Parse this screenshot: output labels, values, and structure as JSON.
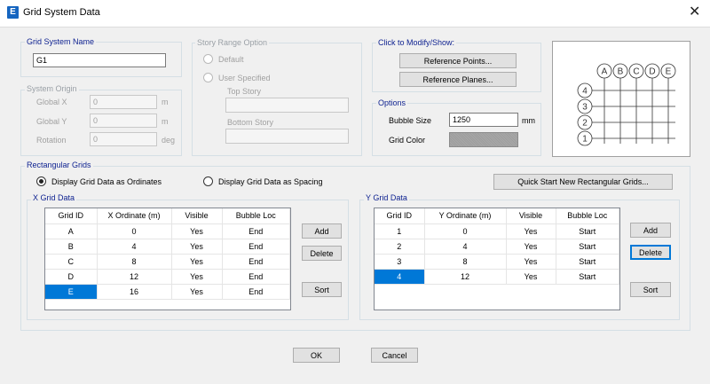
{
  "window": {
    "title": "Grid System Data",
    "app_icon": "E",
    "close_glyph": "✕"
  },
  "grid_system_name": {
    "legend": "Grid System Name",
    "value": "G1"
  },
  "story_range": {
    "legend": "Story Range Option",
    "default_label": "Default",
    "user_specified_label": "User Specified",
    "top_story_label": "Top Story",
    "bottom_story_label": "Bottom Story"
  },
  "system_origin": {
    "legend": "System Origin",
    "global_x": {
      "label": "Global  X",
      "value": "0",
      "unit": "m"
    },
    "global_y": {
      "label": "Global  Y",
      "value": "0",
      "unit": "m"
    },
    "rotation": {
      "label": "Rotation",
      "value": "0",
      "unit": "deg"
    }
  },
  "click_to_modify": {
    "legend": "Click to Modify/Show:",
    "reference_points": "Reference Points...",
    "reference_planes": "Reference Planes..."
  },
  "options": {
    "legend": "Options",
    "bubble_size_label": "Bubble Size",
    "bubble_size_value": "1250",
    "bubble_size_unit": "mm",
    "grid_color_label": "Grid Color",
    "grid_color": "#a4a4a4"
  },
  "preview": {
    "x_bubbles": [
      "A",
      "B",
      "C",
      "D",
      "E"
    ],
    "y_bubbles": [
      "4",
      "3",
      "2",
      "1"
    ]
  },
  "rectangular_grids": {
    "legend": "Rectangular Grids",
    "ordinates_label": "Display Grid Data as Ordinates",
    "spacing_label": "Display Grid Data as Spacing",
    "selected": "ordinates",
    "quick_start": "Quick Start New Rectangular Grids..."
  },
  "x_grid": {
    "legend": "X Grid Data",
    "columns": [
      "Grid ID",
      "X Ordinate (m)",
      "Visible",
      "Bubble Loc"
    ],
    "rows": [
      [
        "A",
        "0",
        "Yes",
        "End"
      ],
      [
        "B",
        "4",
        "Yes",
        "End"
      ],
      [
        "C",
        "8",
        "Yes",
        "End"
      ],
      [
        "D",
        "12",
        "Yes",
        "End"
      ],
      [
        "E",
        "16",
        "Yes",
        "End"
      ]
    ],
    "selected_row": 4,
    "add": "Add",
    "delete": "Delete",
    "sort": "Sort"
  },
  "y_grid": {
    "legend": "Y Grid Data",
    "columns": [
      "Grid ID",
      "Y Ordinate (m)",
      "Visible",
      "Bubble Loc"
    ],
    "rows": [
      [
        "1",
        "0",
        "Yes",
        "Start"
      ],
      [
        "2",
        "4",
        "Yes",
        "Start"
      ],
      [
        "3",
        "8",
        "Yes",
        "Start"
      ],
      [
        "4",
        "12",
        "Yes",
        "Start"
      ]
    ],
    "selected_row": 3,
    "add": "Add",
    "delete": "Delete",
    "sort": "Sort"
  },
  "footer": {
    "ok": "OK",
    "cancel": "Cancel"
  },
  "colors": {
    "accent": "#0078d7",
    "legend_text": "#0b1f8f"
  }
}
